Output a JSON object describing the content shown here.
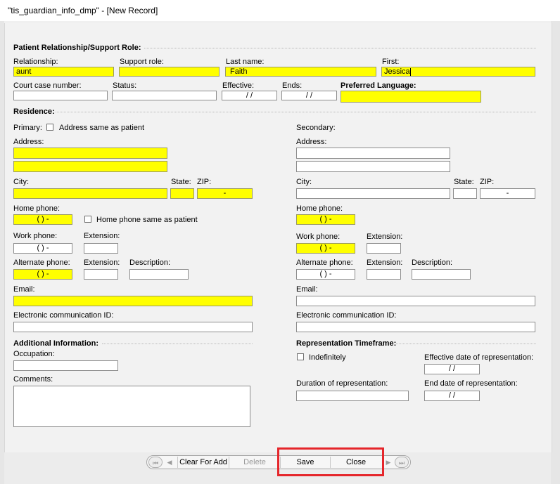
{
  "window": {
    "title": "\"tis_guardian_info_dmp\" - [New Record]"
  },
  "sections": {
    "patient_relationship": "Patient Relationship/Support Role:",
    "residence": "Residence:",
    "additional_info": "Additional Information:",
    "representation_timeframe": "Representation Timeframe:"
  },
  "labels": {
    "relationship": "Relationship:",
    "support_role": "Support role:",
    "last_name": "Last name:",
    "first": "First:",
    "court_case_number": "Court case number:",
    "status": "Status:",
    "effective": "Effective:",
    "ends": "Ends:",
    "preferred_language": "Preferred Language:",
    "primary": "Primary:",
    "address_same": "Address same as patient",
    "secondary": "Secondary:",
    "address": "Address:",
    "city": "City:",
    "state": "State:",
    "zip": "ZIP:",
    "home_phone": "Home phone:",
    "home_phone_same": "Home phone same as patient",
    "work_phone": "Work phone:",
    "extension": "Extension:",
    "alternate_phone": "Alternate phone:",
    "description": "Description:",
    "email": "Email:",
    "ecomm_id": "Electronic communication ID:",
    "occupation": "Occupation:",
    "comments": "Comments:",
    "indefinitely": "Indefinitely",
    "effective_date_rep": "Effective date of representation:",
    "duration_rep": "Duration of representation:",
    "end_date_rep": "End date of representation:"
  },
  "values": {
    "relationship": "aunt",
    "support_role": "",
    "last_name": "Faith",
    "first": "Jessica",
    "court_case_number": "",
    "status": "",
    "effective": "/ /",
    "ends": "/ /",
    "preferred_language": "",
    "zip_mask": "-",
    "phone_mask": "(  )  -",
    "date_mask": "/ /"
  },
  "toolbar": {
    "first": "⏮",
    "prev": "◀",
    "clear_for_add": "Clear For Add",
    "delete": "Delete",
    "save": "Save",
    "close": "Close",
    "next": "▶",
    "last": "⏭"
  },
  "colors": {
    "required_field": "#ffff00",
    "highlight_box": "#e5262b"
  }
}
